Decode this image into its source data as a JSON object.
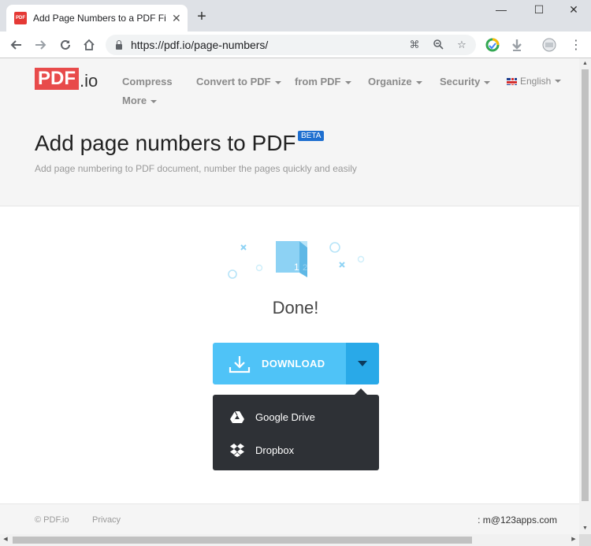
{
  "browser": {
    "tab_title": "Add Page Numbers to a PDF Fi",
    "favicon_text": "PDF",
    "url": "https://pdf.io/page-numbers/"
  },
  "site": {
    "logo_main": "PDF",
    "logo_suffix": ".io",
    "menu": {
      "compress": "Compress",
      "convert": "Convert to PDF",
      "from_pdf": "from PDF",
      "organize": "Organize",
      "security": "Security",
      "more": "More",
      "language": "English"
    }
  },
  "page": {
    "title": "Add page numbers to PDF",
    "badge": "BETA",
    "subtitle": "Add page numbering to PDF document, number the pages quickly and easily",
    "illustration_numbers": [
      "1",
      "2"
    ],
    "status": "Done!"
  },
  "download": {
    "label": "DOWNLOAD",
    "options": [
      "Google Drive",
      "Dropbox"
    ]
  },
  "footer": {
    "copyright": "© PDF.io",
    "privacy": "Privacy",
    "email": ": m@123apps.com"
  },
  "colors": {
    "brand_red": "#e84b4b",
    "download_blue": "#4fc3f7",
    "toggle_blue": "#29a9e8",
    "menu_dark": "#2e3136"
  }
}
